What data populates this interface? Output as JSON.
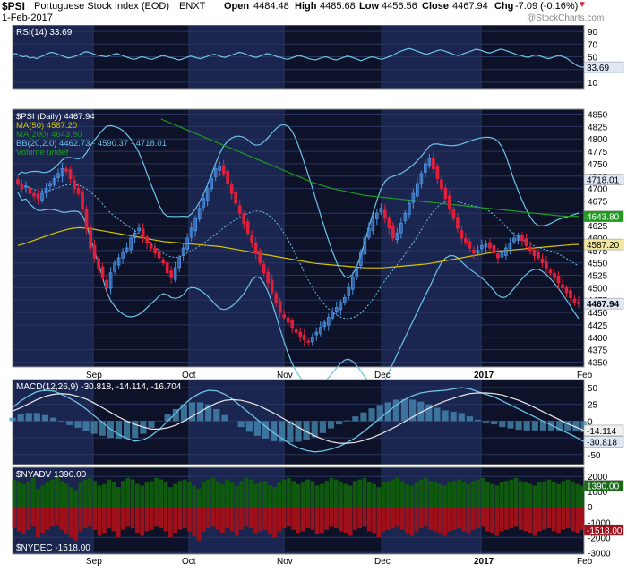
{
  "header": {
    "symbol": "$PSI",
    "name": "Portuguese Stock Index (EOD)",
    "exchange": "ENXT",
    "date": "1-Feb-2017",
    "open_label": "Open",
    "open": "4484.48",
    "high_label": "High",
    "high": "4485.68",
    "low_label": "Low",
    "low": "4456.56",
    "close_label": "Close",
    "close": "4467.94",
    "chg_label": "Chg",
    "chg": "-7.09 (-0.16%)",
    "watermark": "@StockCharts.com"
  },
  "colors": {
    "panel_bg": "#0d1228",
    "band_bg": "#1b2650",
    "grid": "#2a3660",
    "up": "#4a8fe0",
    "down": "#e0203a",
    "ma50": "#d6c300",
    "ma200": "#1f9a1f",
    "bb": "#6cc3e8",
    "rsi": "#6cc3e8",
    "macd": "#6cc3e8",
    "signal": "#e8e8e8",
    "hist": "#4a8fb8",
    "adv": "#0f5a0f",
    "dec": "#a0101a"
  },
  "x_labels": [
    "Sep",
    "Oct",
    "Nov",
    "Dec",
    "2017",
    "Feb"
  ],
  "chart_data": [
    {
      "type": "line",
      "panel": "rsi",
      "legend": "RSI(14) 33.69",
      "yticks": [
        90,
        70,
        50,
        30,
        10
      ],
      "ylim": [
        0,
        100
      ],
      "last_label": "33.69",
      "values": [
        54,
        55,
        52,
        50,
        51,
        48,
        49,
        47,
        50,
        52,
        55,
        57,
        56,
        54,
        52,
        50,
        48,
        49,
        51,
        53,
        56,
        58,
        57,
        55,
        53,
        52,
        51,
        50,
        52,
        54,
        55,
        53,
        51,
        49,
        47,
        46,
        48,
        50,
        49,
        47,
        46,
        48,
        50,
        52,
        51,
        49,
        48,
        46,
        45,
        47,
        49,
        51,
        50,
        48,
        47,
        49,
        51,
        53,
        54,
        52,
        50,
        49,
        51,
        53,
        55,
        57,
        56,
        54,
        52,
        50,
        49,
        51,
        53,
        55,
        54,
        52,
        50,
        49,
        47,
        46,
        48,
        50,
        52,
        51,
        49,
        47,
        46,
        45,
        47,
        49,
        50,
        48,
        46,
        45,
        47,
        49,
        51,
        50,
        48,
        46,
        44,
        46,
        48,
        50,
        49,
        47,
        46,
        48,
        50,
        52,
        55,
        58,
        60,
        62,
        63,
        61,
        59,
        57,
        55,
        54,
        56,
        58,
        60,
        61,
        59,
        57,
        55,
        53,
        52,
        54,
        56,
        58,
        60,
        62,
        61,
        59,
        57,
        56,
        58,
        60,
        62,
        61,
        59,
        57,
        55,
        53,
        52,
        50,
        49,
        51,
        53,
        52,
        50,
        48,
        47,
        49,
        51,
        52,
        50,
        48,
        44,
        40,
        36,
        34,
        33.69
      ]
    },
    {
      "type": "candlestick",
      "panel": "price",
      "legend": "$PSI (Daily) 4467.94",
      "yticks": [
        4850,
        4825,
        4800,
        4775,
        4750,
        4725,
        4700,
        4675,
        4650,
        4625,
        4600,
        4575,
        4550,
        4525,
        4500,
        4475,
        4450,
        4425,
        4400,
        4375,
        4350
      ],
      "ylim": [
        4340,
        4860
      ],
      "series": [
        {
          "name": "MA(50) 4587.20",
          "label": "4587.20",
          "values": [
            4585,
            4588,
            4592,
            4596,
            4600,
            4604,
            4608,
            4612,
            4615,
            4618,
            4620,
            4621,
            4620,
            4619,
            4617,
            4615,
            4613,
            4611,
            4609,
            4607,
            4605,
            4603,
            4601,
            4599,
            4597,
            4595,
            4593,
            4592,
            4591,
            4590,
            4589,
            4588,
            4587,
            4586,
            4585,
            4584,
            4583,
            4581,
            4579,
            4577,
            4575,
            4573,
            4571,
            4569,
            4567,
            4565,
            4563,
            4561,
            4559,
            4557,
            4555,
            4553,
            4551,
            4549,
            4548,
            4547,
            4546,
            4545,
            4544,
            4543,
            4542,
            4541,
            4540,
            4540,
            4540,
            4540,
            4541,
            4542,
            4543,
            4544,
            4545,
            4546,
            4547,
            4548,
            4550,
            4552,
            4554,
            4556,
            4558,
            4560,
            4562,
            4564,
            4566,
            4568,
            4570,
            4572,
            4574,
            4575,
            4576,
            4577,
            4578,
            4579,
            4580,
            4581,
            4582,
            4583,
            4584,
            4585,
            4586,
            4587,
            4587.2
          ]
        },
        {
          "name": "MA(200) 4643.80",
          "label": "4643.80",
          "values": [
            4840,
            4836,
            4832,
            4828,
            4824,
            4820,
            4816,
            4812,
            4808,
            4804,
            4800,
            4796,
            4792,
            4788,
            4784,
            4780,
            4776,
            4772,
            4768,
            4764,
            4760,
            4756,
            4752,
            4748,
            4744,
            4740,
            4736,
            4732,
            4728,
            4724,
            4720,
            4716,
            4712,
            4709,
            4706,
            4703,
            4700,
            4698,
            4696,
            4694,
            4692,
            4690,
            4688,
            4686,
            4685,
            4684,
            4683,
            4682,
            4681,
            4680,
            4679,
            4678,
            4677,
            4676,
            4675,
            4674,
            4673,
            4672,
            4671,
            4670,
            4669,
            4668,
            4667,
            4666,
            4665,
            4664,
            4663,
            4662,
            4661,
            4660,
            4659,
            4658,
            4657,
            4656,
            4655,
            4654,
            4653,
            4652,
            4651,
            4650,
            4649,
            4648,
            4647,
            4646,
            4645,
            4644.5,
            4644,
            4643.9,
            4643.8
          ]
        },
        {
          "name": "BB(20,2.0) 4462.73 - 4590.37 - 4718.01",
          "label": "4718.01"
        }
      ],
      "ma200_start_fraction": 0.26,
      "volume_legend": "Volume undef",
      "bb_last": {
        "lower": "4462.73",
        "mid": "4590.37",
        "upper": "4718.01"
      },
      "last_label": "4467.94",
      "candles_close": [
        4710,
        4700,
        4705,
        4690,
        4685,
        4680,
        4690,
        4700,
        4710,
        4720,
        4730,
        4740,
        4735,
        4720,
        4700,
        4690,
        4660,
        4620,
        4580,
        4560,
        4540,
        4520,
        4500,
        4530,
        4550,
        4560,
        4570,
        4580,
        4600,
        4610,
        4620,
        4600,
        4590,
        4580,
        4570,
        4560,
        4550,
        4530,
        4520,
        4540,
        4560,
        4580,
        4600,
        4620,
        4640,
        4660,
        4680,
        4700,
        4720,
        4740,
        4745,
        4730,
        4710,
        4690,
        4670,
        4650,
        4630,
        4610,
        4590,
        4570,
        4550,
        4530,
        4510,
        4490,
        4470,
        4450,
        4440,
        4430,
        4420,
        4410,
        4400,
        4395,
        4390,
        4400,
        4410,
        4420,
        4430,
        4440,
        4450,
        4460,
        4470,
        4480,
        4500,
        4520,
        4540,
        4570,
        4600,
        4620,
        4640,
        4650,
        4660,
        4640,
        4620,
        4600,
        4610,
        4630,
        4650,
        4670,
        4690,
        4710,
        4730,
        4750,
        4760,
        4740,
        4720,
        4700,
        4680,
        4660,
        4640,
        4620,
        4600,
        4590,
        4580,
        4570,
        4575,
        4585,
        4590,
        4580,
        4570,
        4560,
        4570,
        4580,
        4590,
        4600,
        4605,
        4595,
        4585,
        4575,
        4565,
        4560,
        4550,
        4540,
        4530,
        4520,
        4510,
        4500,
        4490,
        4480,
        4470,
        4467.94
      ]
    },
    {
      "type": "line",
      "panel": "macd",
      "legend": "MACD(12,26,9) -30.818, -14.114, -16.704",
      "yticks": [
        50,
        25,
        0,
        -25,
        -50
      ],
      "ylim": [
        -65,
        62
      ],
      "labels": [
        "-14.114",
        "-30.818"
      ],
      "macd": [
        20,
        30,
        38,
        44,
        46,
        45,
        40,
        34,
        27,
        18,
        8,
        -2,
        -12,
        -20,
        -26,
        -30,
        -28,
        -22,
        -12,
        0,
        12,
        25,
        35,
        42,
        46,
        45,
        40,
        32,
        22,
        12,
        2,
        -8,
        -18,
        -26,
        -34,
        -40,
        -44,
        -46,
        -45,
        -42,
        -38,
        -32,
        -25,
        -16,
        -6,
        4,
        14,
        24,
        32,
        38,
        42,
        44,
        45,
        46,
        48,
        50,
        48,
        44,
        40,
        36,
        30,
        24,
        18,
        12,
        6,
        0,
        -6,
        -12,
        -18,
        -24,
        -30.818
      ],
      "signal": [
        15,
        20,
        26,
        32,
        37,
        40,
        41,
        40,
        37,
        33,
        27,
        20,
        13,
        6,
        0,
        -5,
        -9,
        -12,
        -12,
        -10,
        -6,
        0,
        7,
        14,
        21,
        27,
        31,
        32,
        31,
        28,
        24,
        18,
        12,
        5,
        -2,
        -9,
        -16,
        -22,
        -27,
        -31,
        -33,
        -33,
        -32,
        -29,
        -25,
        -20,
        -14,
        -8,
        -1,
        6,
        13,
        19,
        25,
        30,
        34,
        38,
        41,
        42,
        42,
        41,
        39,
        35,
        31,
        26,
        20,
        14,
        8,
        2,
        -4,
        -9,
        -14.114
      ]
    },
    {
      "type": "bar",
      "panel": "breadth",
      "legend_adv": "$NYADV 1390.00",
      "legend_dec": "$NYDEC -1518.00",
      "yticks": [
        2000,
        1000,
        0,
        -1000,
        -2000,
        -3000
      ],
      "ylim": [
        -3100,
        2600
      ],
      "labels": [
        "1390.00",
        "-1518.00"
      ],
      "adv": [
        1800,
        1600,
        1500,
        1700,
        1900,
        1200,
        1400,
        1600,
        1800,
        2000,
        1700,
        1500,
        1300,
        1100,
        1600,
        1800,
        1900,
        1700,
        1400,
        1500,
        1800,
        1600,
        1300,
        1700,
        1900,
        1800,
        1500,
        1400,
        1600,
        1700,
        1900,
        1800,
        1600,
        1300,
        1500,
        1700,
        1800,
        1600,
        1400,
        1200,
        1600,
        1800,
        1900,
        1700,
        1500,
        1800,
        1600,
        1400,
        1700,
        1900,
        1800,
        1500,
        1600,
        1700,
        1400,
        1300,
        1600,
        1800,
        1900,
        1700,
        1500,
        1600,
        1800,
        1700,
        1400,
        1500,
        1700,
        1900,
        1800,
        1600,
        1500,
        1400,
        1700,
        1800,
        1900,
        1600,
        1500,
        1300,
        1600,
        1700,
        1800,
        1900,
        1700,
        1500,
        1400,
        1600,
        1800,
        1900,
        1700,
        1600,
        1500,
        1400,
        1600,
        1700,
        1800,
        1600,
        1500,
        1700,
        1800,
        1900,
        1600,
        1500,
        1400,
        1600,
        1700,
        1800,
        1900,
        1700,
        1600,
        1500,
        1400,
        1600,
        1700,
        1800,
        1600,
        1500,
        1700,
        1800,
        1600,
        1500,
        1390
      ],
      "dec": [
        -1400,
        -1600,
        -1800,
        -1500,
        -1300,
        -2000,
        -1700,
        -1500,
        -1300,
        -1200,
        -1500,
        -1800,
        -2000,
        -2200,
        -1600,
        -1400,
        -1300,
        -1500,
        -1900,
        -1700,
        -1400,
        -1600,
        -2000,
        -1500,
        -1300,
        -1400,
        -1700,
        -1900,
        -1600,
        -1500,
        -1300,
        -1400,
        -1600,
        -2000,
        -1700,
        -1500,
        -1400,
        -1600,
        -1900,
        -2200,
        -1600,
        -1400,
        -1300,
        -1500,
        -1700,
        -1400,
        -1600,
        -1900,
        -1500,
        -1300,
        -1400,
        -1700,
        -1600,
        -1500,
        -1800,
        -2000,
        -1600,
        -1400,
        -1300,
        -1500,
        -1700,
        -1600,
        -1400,
        -1500,
        -1800,
        -1700,
        -1500,
        -1300,
        -1400,
        -1600,
        -1700,
        -1900,
        -1500,
        -1400,
        -1300,
        -1600,
        -1700,
        -2000,
        -1600,
        -1500,
        -1400,
        -1300,
        -1500,
        -1700,
        -1900,
        -1600,
        -1400,
        -1300,
        -1500,
        -1600,
        -1700,
        -1900,
        -1600,
        -1500,
        -1400,
        -1600,
        -1700,
        -1500,
        -1400,
        -1300,
        -1600,
        -1700,
        -1900,
        -1600,
        -1500,
        -1400,
        -1300,
        -1500,
        -1600,
        -1700,
        -1900,
        -1600,
        -1500,
        -1400,
        -1600,
        -1700,
        -1500,
        -1400,
        -1600,
        -1700,
        -1518
      ]
    }
  ]
}
